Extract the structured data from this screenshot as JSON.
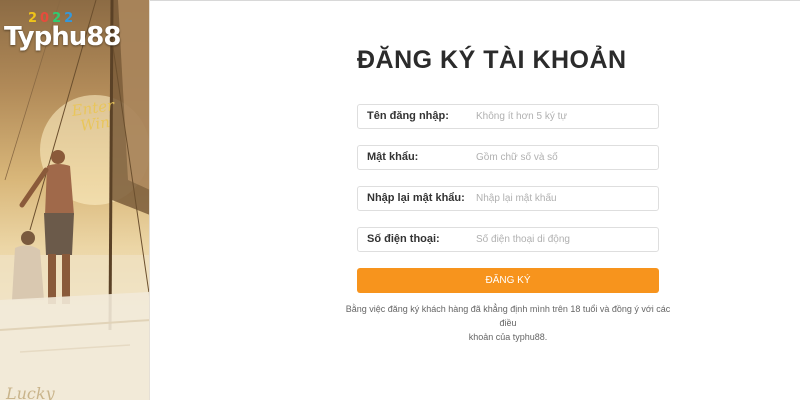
{
  "banner": {
    "logo_text": "Typhu88",
    "logo_year_digits": [
      "2",
      "0",
      "2",
      "2"
    ],
    "script_text": "Enter Win",
    "bottom_script": "Lucky"
  },
  "form": {
    "title": "ĐĂNG KÝ TÀI KHOẢN",
    "fields": [
      {
        "label": "Tên đăng nhập:",
        "placeholder": "Không ít hơn 5 ký tự",
        "value": ""
      },
      {
        "label": "Mật khẩu:",
        "placeholder": "Gồm chữ số và số",
        "value": ""
      },
      {
        "label": "Nhập lại mật khẩu:",
        "placeholder": "Nhập lại mật khẩu",
        "value": ""
      },
      {
        "label": "Số điện thoại:",
        "placeholder": "Số điện thoại di động",
        "value": ""
      }
    ],
    "submit_label": "ĐĂNG KÝ",
    "terms_line1": "Bằng việc đăng ký khách hàng đã khẳng định mình trên 18 tuổi và đồng ý với các điều",
    "terms_line2": "khoản của typhu88."
  },
  "colors": {
    "accent": "#f7941d",
    "border": "#dedede",
    "title": "#2b2b2b"
  }
}
